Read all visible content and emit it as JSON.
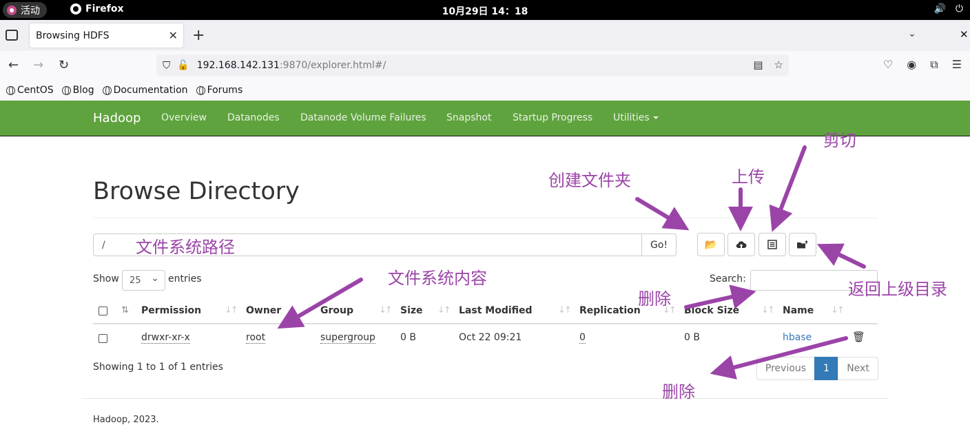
{
  "system": {
    "activities": "活动",
    "app_name": "Firefox",
    "clock": "10月29日  14：18",
    "tray": [
      "🔊",
      "⏻"
    ]
  },
  "browser": {
    "tab_title": "Browsing HDFS",
    "url_host": "192.168.142.131",
    "url_rest": ":9870/explorer.html#/",
    "bookmarks": [
      "CentOS",
      "Blog",
      "Documentation",
      "Forums"
    ]
  },
  "hadoop": {
    "brand": "Hadoop",
    "nav": [
      "Overview",
      "Datanodes",
      "Datanode Volume Failures",
      "Snapshot",
      "Startup Progress",
      "Utilities"
    ]
  },
  "explorer": {
    "title": "Browse Directory",
    "path_value": "/",
    "go_label": "Go!",
    "show_label": "Show",
    "entries_value": "25",
    "entries_label": "entries",
    "search_label": "Search:",
    "columns": [
      "Permission",
      "Owner",
      "Group",
      "Size",
      "Last Modified",
      "Replication",
      "Block Size",
      "Name"
    ],
    "rows": [
      {
        "permission": "drwxr-xr-x",
        "owner": "root",
        "group": "supergroup",
        "size": "0 B",
        "modified": "Oct 22 09:21",
        "replication": "0",
        "block_size": "0 B",
        "name": "hbase"
      }
    ],
    "showing": "Showing 1 to 1 of 1 entries",
    "pager": {
      "previous": "Previous",
      "current": "1",
      "next": "Next"
    },
    "footer": "Hadoop, 2023."
  },
  "annotations": {
    "create_folder": "创建文件夹",
    "upload": "上传",
    "cut": "剪切",
    "path": "文件系统路径",
    "content": "文件系统内容",
    "delete_top": "删除",
    "parent_dir": "返回上级目录",
    "delete_bottom": "删除",
    "color": "#9b44a8"
  }
}
